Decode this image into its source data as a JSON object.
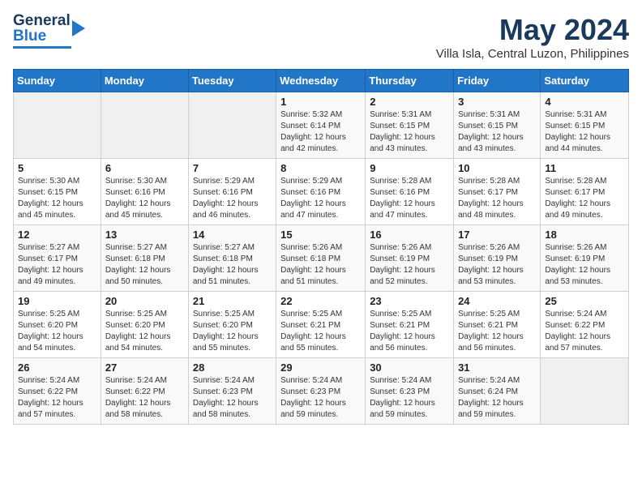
{
  "header": {
    "logo_line1": "General",
    "logo_line2": "Blue",
    "month": "May 2024",
    "location": "Villa Isla, Central Luzon, Philippines"
  },
  "columns": [
    "Sunday",
    "Monday",
    "Tuesday",
    "Wednesday",
    "Thursday",
    "Friday",
    "Saturday"
  ],
  "weeks": [
    [
      {
        "day": "",
        "info": ""
      },
      {
        "day": "",
        "info": ""
      },
      {
        "day": "",
        "info": ""
      },
      {
        "day": "1",
        "info": "Sunrise: 5:32 AM\nSunset: 6:14 PM\nDaylight: 12 hours\nand 42 minutes."
      },
      {
        "day": "2",
        "info": "Sunrise: 5:31 AM\nSunset: 6:15 PM\nDaylight: 12 hours\nand 43 minutes."
      },
      {
        "day": "3",
        "info": "Sunrise: 5:31 AM\nSunset: 6:15 PM\nDaylight: 12 hours\nand 43 minutes."
      },
      {
        "day": "4",
        "info": "Sunrise: 5:31 AM\nSunset: 6:15 PM\nDaylight: 12 hours\nand 44 minutes."
      }
    ],
    [
      {
        "day": "5",
        "info": "Sunrise: 5:30 AM\nSunset: 6:15 PM\nDaylight: 12 hours\nand 45 minutes."
      },
      {
        "day": "6",
        "info": "Sunrise: 5:30 AM\nSunset: 6:16 PM\nDaylight: 12 hours\nand 45 minutes."
      },
      {
        "day": "7",
        "info": "Sunrise: 5:29 AM\nSunset: 6:16 PM\nDaylight: 12 hours\nand 46 minutes."
      },
      {
        "day": "8",
        "info": "Sunrise: 5:29 AM\nSunset: 6:16 PM\nDaylight: 12 hours\nand 47 minutes."
      },
      {
        "day": "9",
        "info": "Sunrise: 5:28 AM\nSunset: 6:16 PM\nDaylight: 12 hours\nand 47 minutes."
      },
      {
        "day": "10",
        "info": "Sunrise: 5:28 AM\nSunset: 6:17 PM\nDaylight: 12 hours\nand 48 minutes."
      },
      {
        "day": "11",
        "info": "Sunrise: 5:28 AM\nSunset: 6:17 PM\nDaylight: 12 hours\nand 49 minutes."
      }
    ],
    [
      {
        "day": "12",
        "info": "Sunrise: 5:27 AM\nSunset: 6:17 PM\nDaylight: 12 hours\nand 49 minutes."
      },
      {
        "day": "13",
        "info": "Sunrise: 5:27 AM\nSunset: 6:18 PM\nDaylight: 12 hours\nand 50 minutes."
      },
      {
        "day": "14",
        "info": "Sunrise: 5:27 AM\nSunset: 6:18 PM\nDaylight: 12 hours\nand 51 minutes."
      },
      {
        "day": "15",
        "info": "Sunrise: 5:26 AM\nSunset: 6:18 PM\nDaylight: 12 hours\nand 51 minutes."
      },
      {
        "day": "16",
        "info": "Sunrise: 5:26 AM\nSunset: 6:19 PM\nDaylight: 12 hours\nand 52 minutes."
      },
      {
        "day": "17",
        "info": "Sunrise: 5:26 AM\nSunset: 6:19 PM\nDaylight: 12 hours\nand 53 minutes."
      },
      {
        "day": "18",
        "info": "Sunrise: 5:26 AM\nSunset: 6:19 PM\nDaylight: 12 hours\nand 53 minutes."
      }
    ],
    [
      {
        "day": "19",
        "info": "Sunrise: 5:25 AM\nSunset: 6:20 PM\nDaylight: 12 hours\nand 54 minutes."
      },
      {
        "day": "20",
        "info": "Sunrise: 5:25 AM\nSunset: 6:20 PM\nDaylight: 12 hours\nand 54 minutes."
      },
      {
        "day": "21",
        "info": "Sunrise: 5:25 AM\nSunset: 6:20 PM\nDaylight: 12 hours\nand 55 minutes."
      },
      {
        "day": "22",
        "info": "Sunrise: 5:25 AM\nSunset: 6:21 PM\nDaylight: 12 hours\nand 55 minutes."
      },
      {
        "day": "23",
        "info": "Sunrise: 5:25 AM\nSunset: 6:21 PM\nDaylight: 12 hours\nand 56 minutes."
      },
      {
        "day": "24",
        "info": "Sunrise: 5:25 AM\nSunset: 6:21 PM\nDaylight: 12 hours\nand 56 minutes."
      },
      {
        "day": "25",
        "info": "Sunrise: 5:24 AM\nSunset: 6:22 PM\nDaylight: 12 hours\nand 57 minutes."
      }
    ],
    [
      {
        "day": "26",
        "info": "Sunrise: 5:24 AM\nSunset: 6:22 PM\nDaylight: 12 hours\nand 57 minutes."
      },
      {
        "day": "27",
        "info": "Sunrise: 5:24 AM\nSunset: 6:22 PM\nDaylight: 12 hours\nand 58 minutes."
      },
      {
        "day": "28",
        "info": "Sunrise: 5:24 AM\nSunset: 6:23 PM\nDaylight: 12 hours\nand 58 minutes."
      },
      {
        "day": "29",
        "info": "Sunrise: 5:24 AM\nSunset: 6:23 PM\nDaylight: 12 hours\nand 59 minutes."
      },
      {
        "day": "30",
        "info": "Sunrise: 5:24 AM\nSunset: 6:23 PM\nDaylight: 12 hours\nand 59 minutes."
      },
      {
        "day": "31",
        "info": "Sunrise: 5:24 AM\nSunset: 6:24 PM\nDaylight: 12 hours\nand 59 minutes."
      },
      {
        "day": "",
        "info": ""
      }
    ]
  ]
}
